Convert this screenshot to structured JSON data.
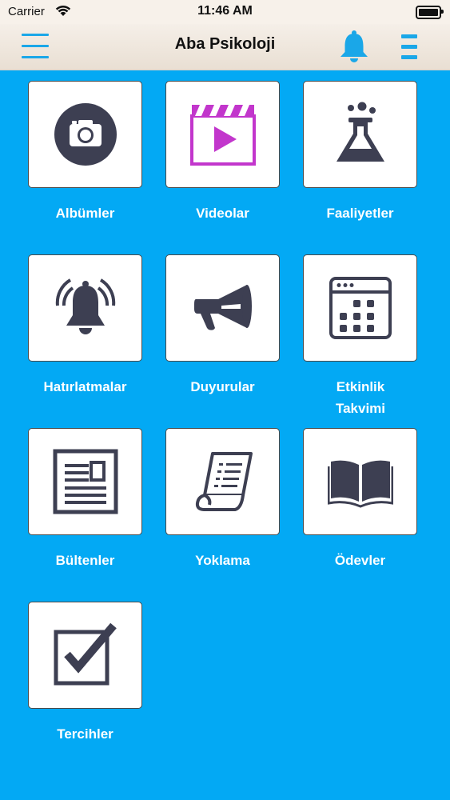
{
  "status_bar": {
    "carrier": "Carrier",
    "time": "11:46 AM"
  },
  "header": {
    "title": "Aba Psikoloji"
  },
  "grid": {
    "items": [
      {
        "label": "Albümler",
        "icon": "camera-icon"
      },
      {
        "label": "Videolar",
        "icon": "video-clapper-icon"
      },
      {
        "label": "Faaliyetler",
        "icon": "flask-icon"
      },
      {
        "label": "Hatırlatmalar",
        "icon": "alarm-bell-icon"
      },
      {
        "label": "Duyurular",
        "icon": "megaphone-icon"
      },
      {
        "label": "Etkinlik Takvimi",
        "icon": "calendar-icon"
      },
      {
        "label": "Bültenler",
        "icon": "newsletter-icon"
      },
      {
        "label": "Yoklama",
        "icon": "document-scroll-icon"
      },
      {
        "label": "Ödevler",
        "icon": "open-book-icon"
      },
      {
        "label": "Tercihler",
        "icon": "checkbox-icon"
      }
    ]
  },
  "colors": {
    "background": "#03a9f4",
    "accent": "#1aa7e8",
    "icon_dark": "#3d3f52",
    "video_icon": "#c236cc"
  }
}
